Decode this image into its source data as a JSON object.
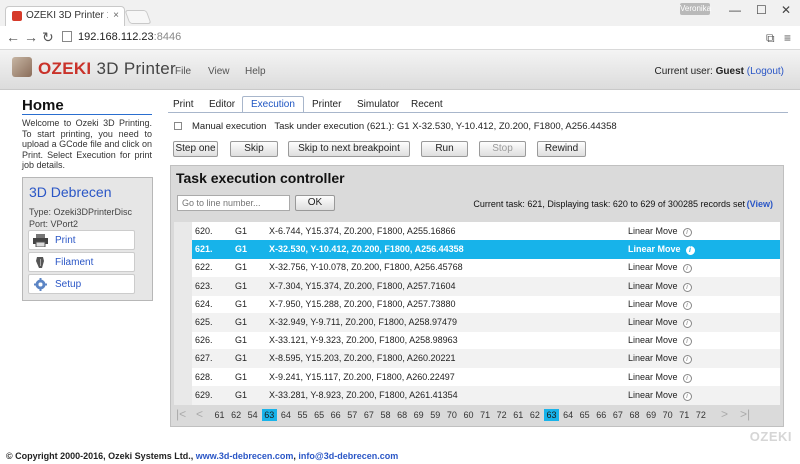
{
  "browser": {
    "tab_title": "OZEKI 3D Printer 1.1.0 (19...",
    "tab_close": "×",
    "user_badge": "Veronika",
    "address_host": "192.168.112.23",
    "address_port": ":8446"
  },
  "header": {
    "logo_brand": "OZEKI",
    "logo_product": " 3D Printer",
    "menu": [
      "File",
      "View",
      "Help"
    ],
    "current_user_label": "Current user: ",
    "current_user": "Guest",
    "logout": "(Logout)"
  },
  "sidebar": {
    "title": "Home",
    "intro": "Welcome to Ozeki 3D Printing. To start printing, you need to upload a GCode file and click on Print. Select Execution for print job details.",
    "device": {
      "name": "3D Debrecen",
      "type": "Type: Ozeki3DPrinterDisc",
      "port": "Port: VPort2",
      "buttons": [
        "Print",
        "Filament",
        "Setup"
      ]
    }
  },
  "tabs": [
    "Print",
    "Editor",
    "Execution",
    "Printer",
    "Simulator",
    "Recent"
  ],
  "active_tab": "Execution",
  "execution": {
    "manual_label": "Manual execution",
    "task_line": "Task under execution (621.): G1 X-32.530, Y-10.412, Z0.200, F1800, A256.44358",
    "buttons": [
      "Step one",
      "Skip",
      "Skip to next breakpoint",
      "Run",
      "Stop",
      "Rewind"
    ]
  },
  "panel": {
    "title": "Task execution controller",
    "goto_placeholder": "Go to line number...",
    "ok": "OK",
    "current_task": "Current task: 621, Displaying task: 620 to 629 of 300285 records set",
    "view": "(View)",
    "rows": [
      {
        "num": "620.",
        "cmd": "G1",
        "params": "X-6.744, Y15.374, Z0.200, F1800, A255.16866",
        "type": "Linear Move"
      },
      {
        "num": "621.",
        "cmd": "G1",
        "params": "X-32.530, Y-10.412, Z0.200, F1800, A256.44358",
        "type": "Linear Move"
      },
      {
        "num": "622.",
        "cmd": "G1",
        "params": "X-32.756, Y-10.078, Z0.200, F1800, A256.45768",
        "type": "Linear Move"
      },
      {
        "num": "623.",
        "cmd": "G1",
        "params": "X-7.304, Y15.374, Z0.200, F1800, A257.71604",
        "type": "Linear Move"
      },
      {
        "num": "624.",
        "cmd": "G1",
        "params": "X-7.950, Y15.288, Z0.200, F1800, A257.73880",
        "type": "Linear Move"
      },
      {
        "num": "625.",
        "cmd": "G1",
        "params": "X-32.949, Y-9.711, Z0.200, F1800, A258.97479",
        "type": "Linear Move"
      },
      {
        "num": "626.",
        "cmd": "G1",
        "params": "X-33.121, Y-9.323, Z0.200, F1800, A258.98963",
        "type": "Linear Move"
      },
      {
        "num": "627.",
        "cmd": "G1",
        "params": "X-8.595, Y15.203, Z0.200, F1800, A260.20221",
        "type": "Linear Move"
      },
      {
        "num": "628.",
        "cmd": "G1",
        "params": "X-9.241, Y15.117, Z0.200, F1800, A260.22497",
        "type": "Linear Move"
      },
      {
        "num": "629.",
        "cmd": "G1",
        "params": "X-33.281, Y-8.923, Z0.200, F1800, A261.41354",
        "type": "Linear Move"
      }
    ],
    "info_glyph": "i",
    "pager": [
      "61",
      "62",
      "54",
      "63",
      "64",
      "55",
      "65",
      "66",
      "57",
      "67",
      "58",
      "68",
      "69",
      "59",
      "70",
      "60",
      "71",
      "72",
      "61",
      "62",
      "63",
      "64",
      "65",
      "66",
      "67",
      "68",
      "69",
      "70",
      "71",
      "72"
    ],
    "pager_current": "63"
  },
  "watermark": "OZEKI",
  "footer": {
    "copyright": "© Copyright 2000-2016, Ozeki Systems Ltd., ",
    "link1": "www.3d-debrecen.com",
    "sep": ", ",
    "link2": "info@3d-debrecen.com"
  },
  "colors": {
    "accent": "#17b3ea",
    "brand": "#c9322a",
    "link": "#2a56c6"
  }
}
